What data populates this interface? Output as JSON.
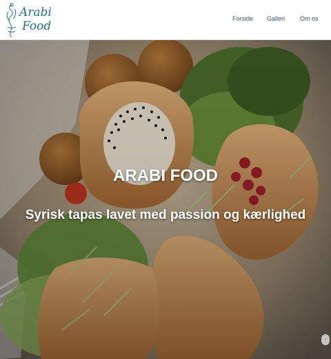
{
  "brand": {
    "line1": "Arabi",
    "line2": "Food",
    "accent": "#2a6f86"
  },
  "nav": {
    "items": [
      {
        "label": "Forside"
      },
      {
        "label": "Galleri"
      },
      {
        "label": "Om os"
      }
    ]
  },
  "hero": {
    "title": "ARABI FOOD",
    "subtitle": "Syrisk tapas lavet med passion og kærlighed"
  },
  "scroll_top": {
    "icon": "scroll-top-icon",
    "glyph": "↑"
  }
}
